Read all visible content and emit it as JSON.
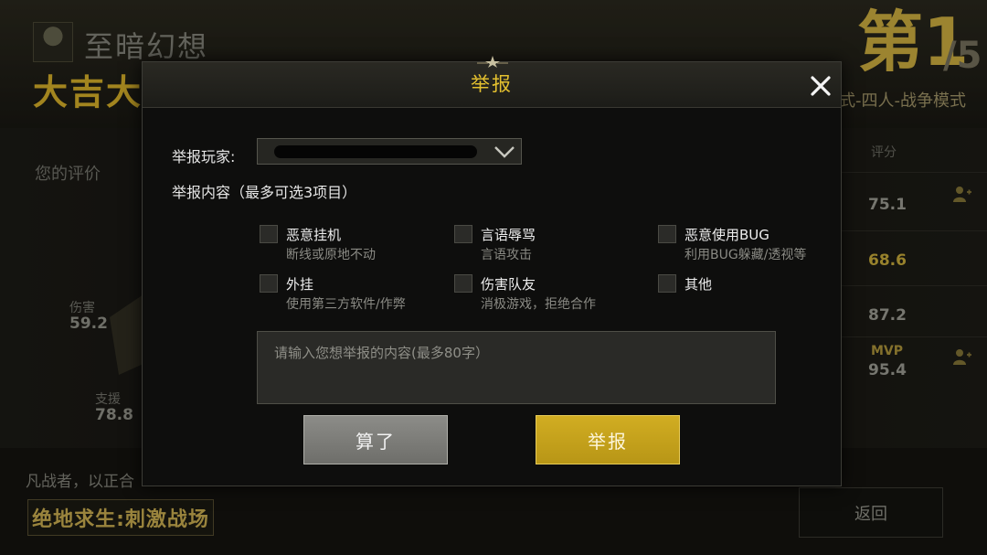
{
  "background": {
    "player_name": "至暗幻想",
    "win_text": "大吉大",
    "rank": "第1",
    "rank_total": "/5",
    "mode": "式-四人-战争模式",
    "eval_title": "您的评价",
    "radar": {
      "harm_label": "伤害",
      "harm_value": "59.2",
      "support_label": "支援",
      "support_value": "78.8"
    },
    "score_header": "评分",
    "scores": [
      "75.1",
      "68.6",
      "87.2",
      "95.4"
    ],
    "mvp_label": "MVP",
    "slogan": "凡战者，以正合",
    "logo_text": "绝地求生:刺激战场",
    "back_label": "返回"
  },
  "modal": {
    "title": "举报",
    "reported_player_label": "举报玩家:",
    "content_label": "举报内容（最多可选3项目）",
    "options": [
      {
        "title": "恶意挂机",
        "subtitle": "断线或原地不动",
        "checked": false
      },
      {
        "title": "言语辱骂",
        "subtitle": "言语攻击",
        "checked": false
      },
      {
        "title": "恶意使用BUG",
        "subtitle": "利用BUG躲藏/透视等",
        "checked": false
      },
      {
        "title": "外挂",
        "subtitle": "使用第三方软件/作弊",
        "checked": false
      },
      {
        "title": "伤害队友",
        "subtitle": "消极游戏，拒绝合作",
        "checked": false
      },
      {
        "title": "其他",
        "subtitle": "",
        "checked": false
      }
    ],
    "detail_placeholder": "请输入您想举报的内容(最多80字）",
    "cancel_label": "算了",
    "submit_label": "举报"
  },
  "colors": {
    "accent_gold": "#e3c02f",
    "button_gold": "#c9a41d",
    "button_gray": "#7e7e7a"
  }
}
